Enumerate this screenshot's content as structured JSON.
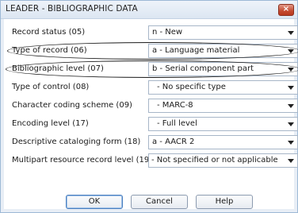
{
  "window": {
    "title": "LEADER - BIBLIOGRAPHIC DATA",
    "close_label": "×"
  },
  "fields": [
    {
      "label": "Record status (05)",
      "value": "n - New"
    },
    {
      "label": "Type of record (06)",
      "value": "a - Language material"
    },
    {
      "label": "Bibliographic level (07)",
      "value": "b - Serial component part"
    },
    {
      "label": "Type of control (08)",
      "value": " - No specific type"
    },
    {
      "label": "Character coding scheme (09)",
      "value": " - MARC-8"
    },
    {
      "label": "Encoding level (17)",
      "value": " - Full level"
    },
    {
      "label": "Descriptive cataloging form (18)",
      "value": "a - AACR 2"
    },
    {
      "label": "Multipart resource record level (19)",
      "value": " - Not specified or not applicable"
    }
  ],
  "buttons": {
    "ok": "OK",
    "cancel": "Cancel",
    "help": "Help"
  },
  "icons": {
    "close": "close-icon",
    "dropdown": "chevron-down-icon"
  }
}
